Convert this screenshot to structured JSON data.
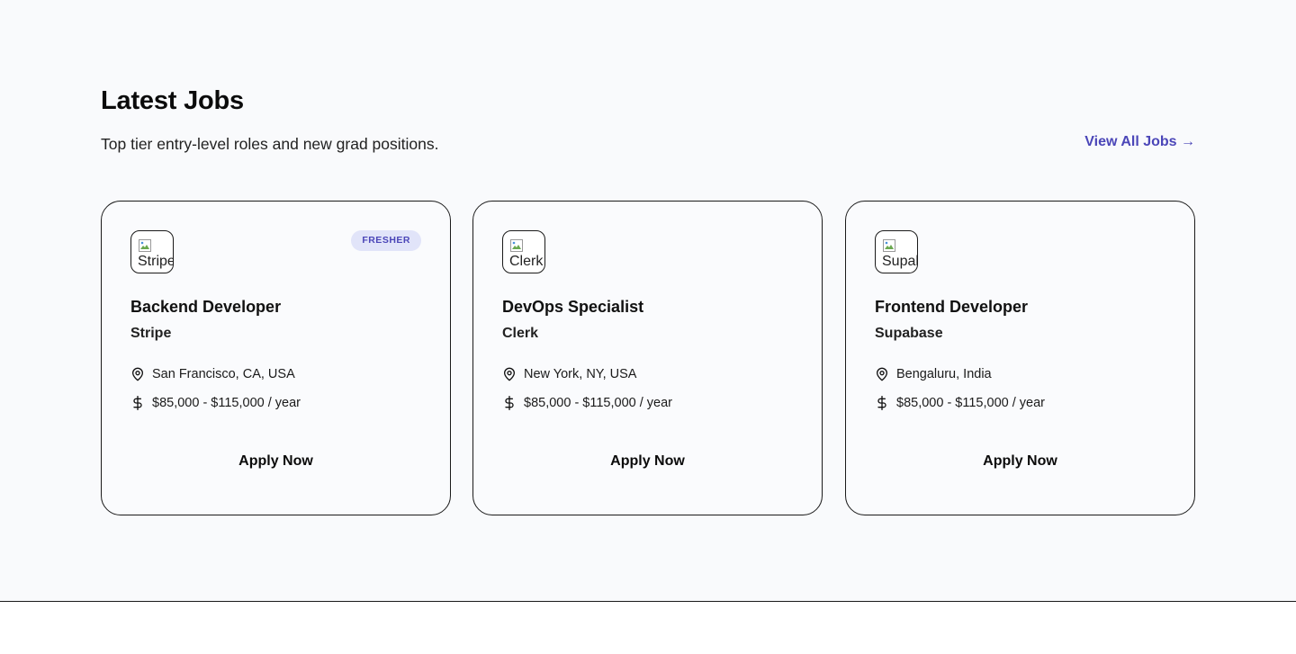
{
  "section": {
    "title": "Latest Jobs",
    "subtitle": "Top tier entry-level roles and new grad positions.",
    "view_all_label": "View All Jobs →"
  },
  "colors": {
    "accent": "#4b46b8",
    "badge_bg": "#e1e4f9",
    "page_bg": "#f9fafc"
  },
  "icons": {
    "location": "map-pin-icon",
    "salary": "dollar-icon",
    "logo_placeholder": "broken-image-icon"
  },
  "jobs": [
    {
      "logo_alt": "Stripe",
      "badge": "FRESHER",
      "title": "Backend Developer",
      "company": "Stripe",
      "location": "San Francisco, CA, USA",
      "salary": "$85,000 - $115,000 / year",
      "apply_label": "Apply Now"
    },
    {
      "logo_alt": "Clerk",
      "title": "DevOps Specialist",
      "company": "Clerk",
      "location": "New York, NY, USA",
      "salary": "$85,000 - $115,000 / year",
      "apply_label": "Apply Now"
    },
    {
      "logo_alt": "Supabase",
      "title": "Frontend Developer",
      "company": "Supabase",
      "location": "Bengaluru, India",
      "salary": "$85,000 - $115,000 / year",
      "apply_label": "Apply Now"
    }
  ]
}
